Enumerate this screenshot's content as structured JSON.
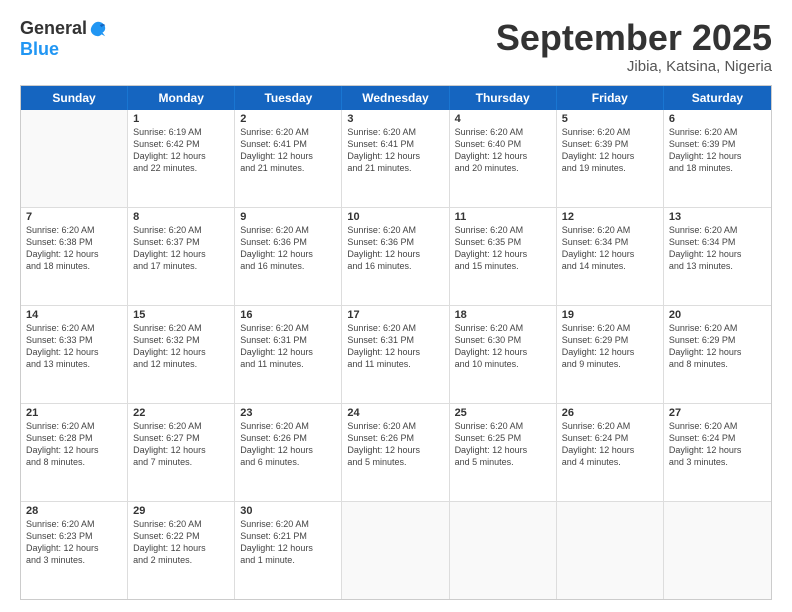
{
  "header": {
    "logo_general": "General",
    "logo_blue": "Blue",
    "month_title": "September 2025",
    "location": "Jibia, Katsina, Nigeria"
  },
  "days_of_week": [
    "Sunday",
    "Monday",
    "Tuesday",
    "Wednesday",
    "Thursday",
    "Friday",
    "Saturday"
  ],
  "rows": [
    [
      {
        "day": "",
        "text": ""
      },
      {
        "day": "1",
        "text": "Sunrise: 6:19 AM\nSunset: 6:42 PM\nDaylight: 12 hours\nand 22 minutes."
      },
      {
        "day": "2",
        "text": "Sunrise: 6:20 AM\nSunset: 6:41 PM\nDaylight: 12 hours\nand 21 minutes."
      },
      {
        "day": "3",
        "text": "Sunrise: 6:20 AM\nSunset: 6:41 PM\nDaylight: 12 hours\nand 21 minutes."
      },
      {
        "day": "4",
        "text": "Sunrise: 6:20 AM\nSunset: 6:40 PM\nDaylight: 12 hours\nand 20 minutes."
      },
      {
        "day": "5",
        "text": "Sunrise: 6:20 AM\nSunset: 6:39 PM\nDaylight: 12 hours\nand 19 minutes."
      },
      {
        "day": "6",
        "text": "Sunrise: 6:20 AM\nSunset: 6:39 PM\nDaylight: 12 hours\nand 18 minutes."
      }
    ],
    [
      {
        "day": "7",
        "text": "Sunrise: 6:20 AM\nSunset: 6:38 PM\nDaylight: 12 hours\nand 18 minutes."
      },
      {
        "day": "8",
        "text": "Sunrise: 6:20 AM\nSunset: 6:37 PM\nDaylight: 12 hours\nand 17 minutes."
      },
      {
        "day": "9",
        "text": "Sunrise: 6:20 AM\nSunset: 6:36 PM\nDaylight: 12 hours\nand 16 minutes."
      },
      {
        "day": "10",
        "text": "Sunrise: 6:20 AM\nSunset: 6:36 PM\nDaylight: 12 hours\nand 16 minutes."
      },
      {
        "day": "11",
        "text": "Sunrise: 6:20 AM\nSunset: 6:35 PM\nDaylight: 12 hours\nand 15 minutes."
      },
      {
        "day": "12",
        "text": "Sunrise: 6:20 AM\nSunset: 6:34 PM\nDaylight: 12 hours\nand 14 minutes."
      },
      {
        "day": "13",
        "text": "Sunrise: 6:20 AM\nSunset: 6:34 PM\nDaylight: 12 hours\nand 13 minutes."
      }
    ],
    [
      {
        "day": "14",
        "text": "Sunrise: 6:20 AM\nSunset: 6:33 PM\nDaylight: 12 hours\nand 13 minutes."
      },
      {
        "day": "15",
        "text": "Sunrise: 6:20 AM\nSunset: 6:32 PM\nDaylight: 12 hours\nand 12 minutes."
      },
      {
        "day": "16",
        "text": "Sunrise: 6:20 AM\nSunset: 6:31 PM\nDaylight: 12 hours\nand 11 minutes."
      },
      {
        "day": "17",
        "text": "Sunrise: 6:20 AM\nSunset: 6:31 PM\nDaylight: 12 hours\nand 11 minutes."
      },
      {
        "day": "18",
        "text": "Sunrise: 6:20 AM\nSunset: 6:30 PM\nDaylight: 12 hours\nand 10 minutes."
      },
      {
        "day": "19",
        "text": "Sunrise: 6:20 AM\nSunset: 6:29 PM\nDaylight: 12 hours\nand 9 minutes."
      },
      {
        "day": "20",
        "text": "Sunrise: 6:20 AM\nSunset: 6:29 PM\nDaylight: 12 hours\nand 8 minutes."
      }
    ],
    [
      {
        "day": "21",
        "text": "Sunrise: 6:20 AM\nSunset: 6:28 PM\nDaylight: 12 hours\nand 8 minutes."
      },
      {
        "day": "22",
        "text": "Sunrise: 6:20 AM\nSunset: 6:27 PM\nDaylight: 12 hours\nand 7 minutes."
      },
      {
        "day": "23",
        "text": "Sunrise: 6:20 AM\nSunset: 6:26 PM\nDaylight: 12 hours\nand 6 minutes."
      },
      {
        "day": "24",
        "text": "Sunrise: 6:20 AM\nSunset: 6:26 PM\nDaylight: 12 hours\nand 5 minutes."
      },
      {
        "day": "25",
        "text": "Sunrise: 6:20 AM\nSunset: 6:25 PM\nDaylight: 12 hours\nand 5 minutes."
      },
      {
        "day": "26",
        "text": "Sunrise: 6:20 AM\nSunset: 6:24 PM\nDaylight: 12 hours\nand 4 minutes."
      },
      {
        "day": "27",
        "text": "Sunrise: 6:20 AM\nSunset: 6:24 PM\nDaylight: 12 hours\nand 3 minutes."
      }
    ],
    [
      {
        "day": "28",
        "text": "Sunrise: 6:20 AM\nSunset: 6:23 PM\nDaylight: 12 hours\nand 3 minutes."
      },
      {
        "day": "29",
        "text": "Sunrise: 6:20 AM\nSunset: 6:22 PM\nDaylight: 12 hours\nand 2 minutes."
      },
      {
        "day": "30",
        "text": "Sunrise: 6:20 AM\nSunset: 6:21 PM\nDaylight: 12 hours\nand 1 minute."
      },
      {
        "day": "",
        "text": ""
      },
      {
        "day": "",
        "text": ""
      },
      {
        "day": "",
        "text": ""
      },
      {
        "day": "",
        "text": ""
      }
    ]
  ]
}
